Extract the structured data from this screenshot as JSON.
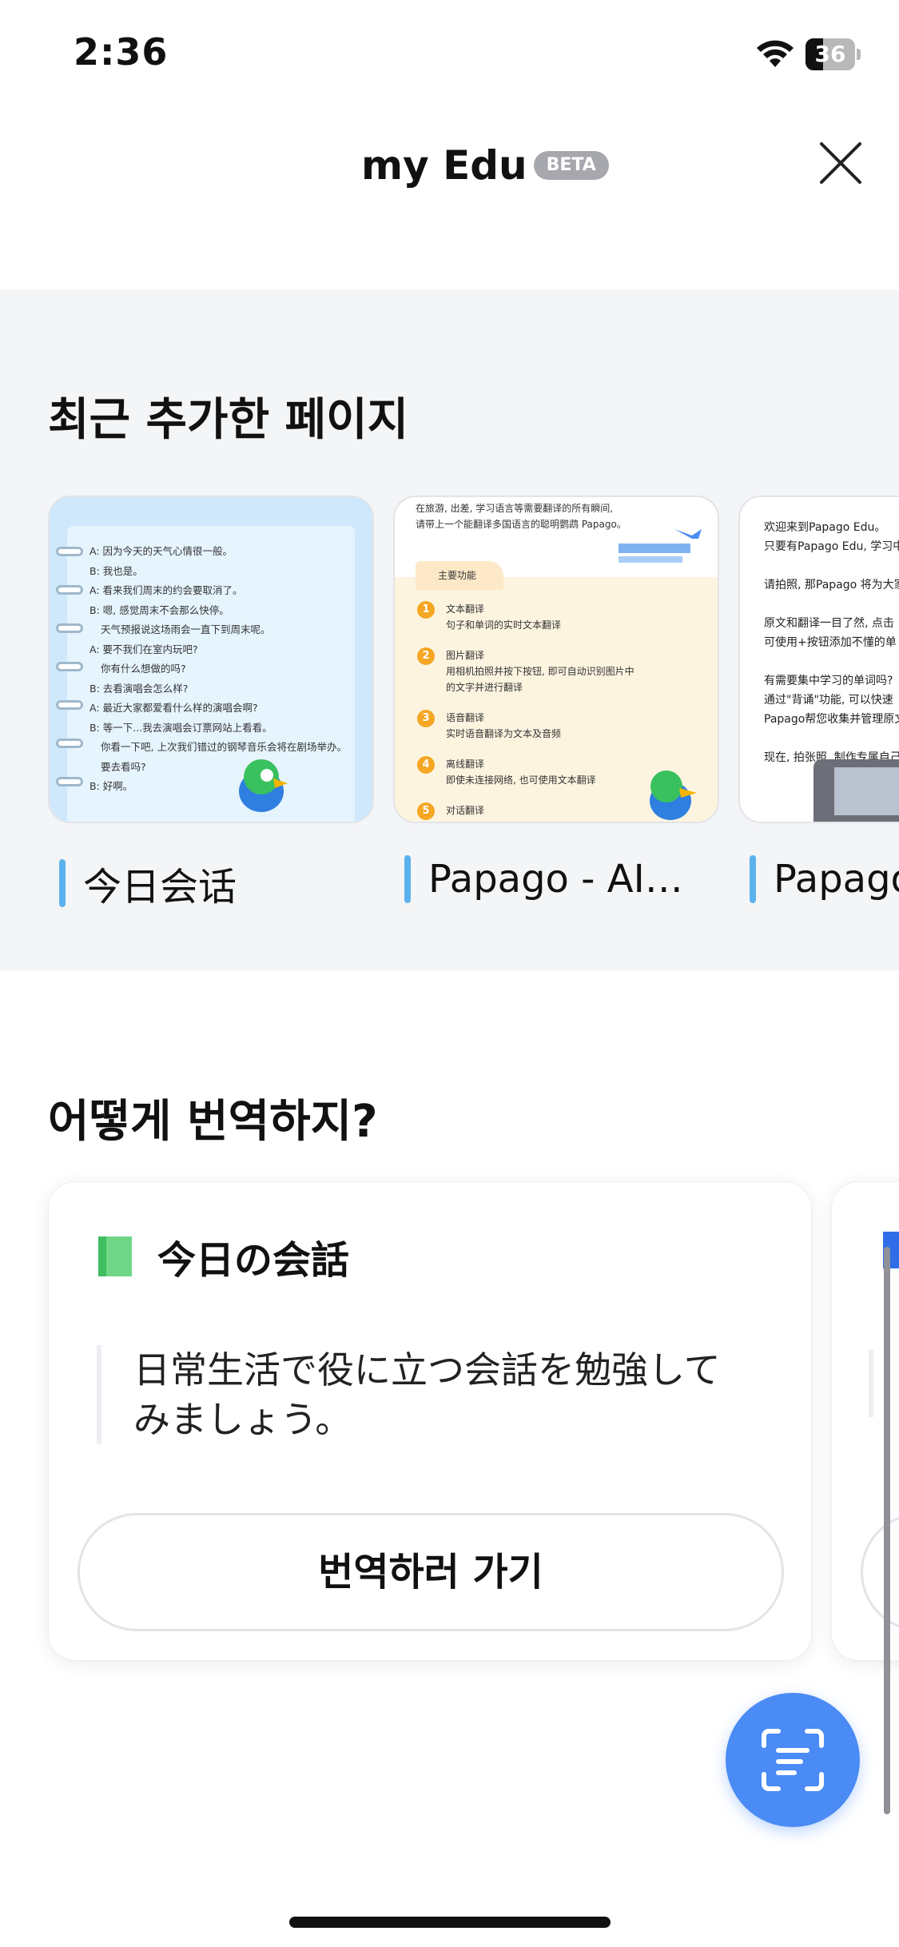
{
  "status_bar": {
    "time": "2:36",
    "battery": "36",
    "battery_level": 0.36
  },
  "header": {
    "title": "my Edu",
    "badge": "BETA"
  },
  "recent_section": {
    "title": "최근 추가한 페이지",
    "pages": [
      {
        "label": "今日会话",
        "lines": [
          "A: 因为今天的天气心情很一般。",
          "B: 我也是。",
          "A: 看来我们周末的约会要取消了。",
          "B: 嗯, 感觉周末不会那么快停。",
          "天气预报说这场雨会一直下到周末呢。",
          "A: 要不我们在室内玩吧?",
          "你有什么想做的吗?",
          "B: 去看演唱会怎么样?",
          "A: 最近大家都爱看什么样的演唱会啊?",
          "B: 等一下...我去演唱会订票网站上看看。",
          "你看一下吧, 上次我们错过的钢琴音乐会将在剧场举办。",
          "要去看吗?",
          "B: 好啊。"
        ]
      },
      {
        "label": "Papago - AI…",
        "top_lines": [
          "在旅游, 出差, 学习语言等需要翻译的所有瞬间,",
          "请带上一个能翻译多国语言的聪明鹦鹉 Papago。"
        ],
        "section_head": "主要功能",
        "features": [
          {
            "num": "1",
            "title": "文本翻译",
            "desc": "句子和单词的实时文本翻译"
          },
          {
            "num": "2",
            "title": "图片翻译",
            "desc": "用相机拍照并按下按钮, 即可自动识别图片中的文字并进行翻译"
          },
          {
            "num": "3",
            "title": "语音翻译",
            "desc": "实时语音翻译为文本及音频"
          },
          {
            "num": "4",
            "title": "离线翻译",
            "desc": "即使未连接网络, 也可使用文本翻译"
          },
          {
            "num": "5",
            "title": "对话翻译",
            "desc": ""
          }
        ]
      },
      {
        "label": "Papago",
        "lines": [
          "欢迎来到Papago Edu。",
          "只要有Papago Edu, 学习中",
          "",
          "请拍照, 那Papago 将为大家",
          "",
          "原文和翻译一目了然, 点击",
          "可使用+按钮添加不懂的单",
          "",
          "有需要集中学习的单词吗?",
          "通过\"背诵\"功能, 可以快速",
          "Papago帮您收集并管理原文",
          "",
          "现在, 拍张照, 制作专属自己"
        ]
      }
    ]
  },
  "how_section": {
    "title": "어떻게 번역하지?",
    "card": {
      "title": "今日の会話",
      "description": "日常生活で役に立つ会話を勉強してみましょう。",
      "button_label": "번역하러 가기"
    }
  },
  "icons": {
    "close": "close-icon",
    "scan": "scan-text-icon",
    "wifi": "wifi-icon"
  },
  "colors": {
    "accent_blue": "#4a8bf5",
    "label_bar": "#5cb2ec",
    "book_green": "#6fd688",
    "section_bg": "#f4f5f7"
  }
}
